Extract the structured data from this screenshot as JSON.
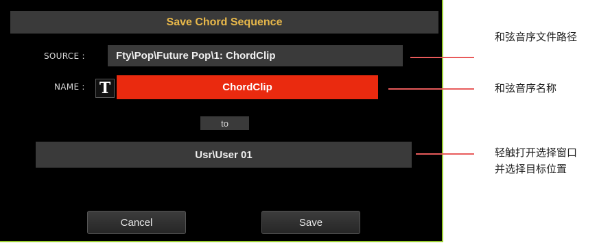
{
  "dialog": {
    "title": "Save Chord Sequence",
    "source_label": "SOURCE :",
    "source_value": "Fty\\Pop\\Future Pop\\1: ChordClip",
    "name_label": "NAME :",
    "text_edit_icon_glyph": "T",
    "name_value": "ChordClip",
    "to_label": "to",
    "destination_value": "Usr\\User 01",
    "cancel_label": "Cancel",
    "save_label": "Save"
  },
  "callouts": {
    "path": "和弦音序文件路径",
    "name": "和弦音序名称",
    "dest_line1": "轻触打开选择窗口",
    "dest_line2": "并选择目标位置"
  },
  "colors": {
    "accent_title": "#e8b84a",
    "name_field": "#ea2a0f",
    "border": "#9acd32",
    "callout_line": "#e85a5a"
  }
}
